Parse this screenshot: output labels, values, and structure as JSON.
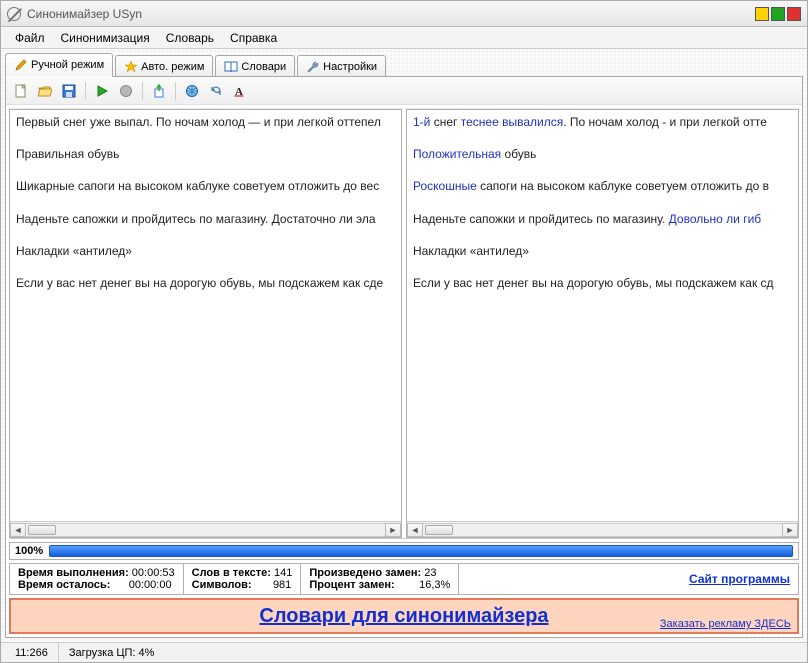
{
  "title": "Синонимайзер USyn",
  "menu": {
    "file": "Файл",
    "syn": "Синонимизация",
    "dict": "Словарь",
    "help": "Справка"
  },
  "tabs": {
    "manual": "Ручной режим",
    "auto": "Авто. режим",
    "dicts": "Словари",
    "settings": "Настройки"
  },
  "toolbar": {
    "new": "new",
    "open": "open",
    "save": "save",
    "run": "run",
    "stop": "stop",
    "export": "export",
    "globe": "globe",
    "refresh": "refresh",
    "font": "font"
  },
  "left": {
    "p1": "Первый снег уже выпал. По ночам холод — и при легкой оттепел",
    "p2": "Правильная обувь",
    "p3": "Шикарные сапоги на высоком каблуке советуем отложить до вес",
    "p4": "Наденьте сапожки и пройдитесь по магазину. Достаточно ли эла",
    "p5": "Накладки «антилед»",
    "p6": "Если у вас нет денег вы на дорогую обувь, мы подскажем как сде"
  },
  "right": {
    "p1a": "1-й",
    "p1b": " снег ",
    "p1c": "теснее",
    "p1d": " ",
    "p1e": "вывалился",
    "p1f": ". По ночам холод - и при легкой отте",
    "p2a": "Положительная",
    "p2b": " обувь",
    "p3a": "Роскошные",
    "p3b": " сапоги на высоком каблуке советуем отложить до в",
    "p4a": "Наденьте сапожки и пройдитесь по магазину. ",
    "p4b": "Довольно ли",
    "p4c": " ",
    "p4d": "гиб",
    "p5": "Накладки «антилед»",
    "p6": "Если у вас нет денег вы на дорогую обувь, мы подскажем как сд"
  },
  "progress": {
    "pct": "100%"
  },
  "stats": {
    "time_exec_lbl": "Время выполнения:",
    "time_exec_val": "00:00:53",
    "time_left_lbl": "Время осталось:",
    "time_left_val": "00:00:00",
    "words_lbl": "Слов в тексте:",
    "words_val": "141",
    "chars_lbl": "Символов:",
    "chars_val": "981",
    "repl_lbl": "Произведено замен:",
    "repl_val": "23",
    "pct_lbl": "Процент замен:",
    "pct_val": "16,3%",
    "site_link": "Сайт программы"
  },
  "ad": {
    "main": "Словари для синонимайзера",
    "small": "Заказать рекламу ЗДЕСЬ"
  },
  "status": {
    "pos": "11:266",
    "cpu": "Загрузка ЦП: 4%"
  }
}
